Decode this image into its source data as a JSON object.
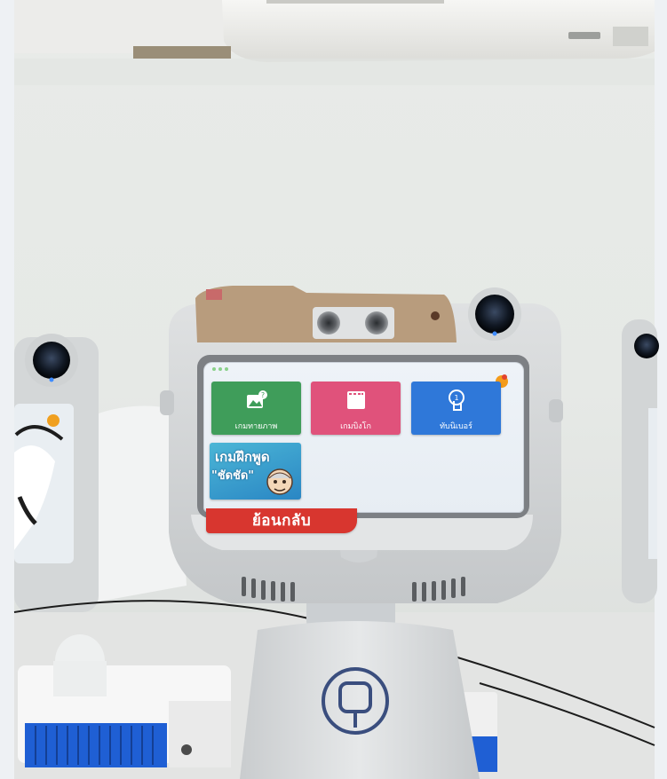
{
  "screen": {
    "tiles": [
      {
        "id": "gallery",
        "label": "เกมทายภาพ",
        "color": "#3f9d5a"
      },
      {
        "id": "bingo",
        "label": "เกมบิงโก",
        "color": "#e0527b"
      },
      {
        "id": "numbers",
        "label": "ทับนิเบอร์",
        "color": "#2f78d9"
      }
    ],
    "speech_game": {
      "title": "เกมฝึกพูด",
      "subtitle": "\"ชัดชัด\""
    },
    "back_label": "ย้อนกลับ"
  },
  "colors": {
    "back_bar": "#d8362f",
    "robot_body": "#d9dcdd",
    "camera_band": "#b89c7d"
  }
}
